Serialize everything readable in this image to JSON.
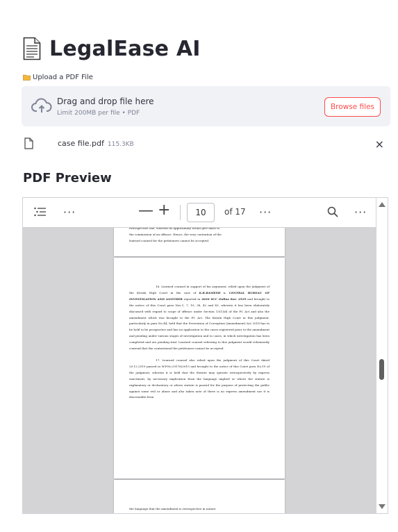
{
  "app": {
    "title": "LegalEase AI",
    "icon": "document-icon"
  },
  "uploader": {
    "label": "Upload a PDF File",
    "drop_text": "Drag and drop file here",
    "limit_text": "Limit 200MB per file • PDF",
    "browse_label": "Browse files",
    "accent_color": "#ff4b4b"
  },
  "uploaded_file": {
    "name": "case file.pdf",
    "size": "115.3KB",
    "remove_label": "×"
  },
  "preview": {
    "heading": "PDF Preview",
    "toolbar": {
      "more": "···",
      "zoom_out": "—",
      "zoom_in": "+",
      "current_page": "10",
      "page_total": "of 17"
    },
    "page_prev_text": [
      "retrospective one, wherein its applicability would give basis to",
      "the commission of an offence. Hence, the very contention of the",
      "learned counsel for the petitioners cannot be accepted."
    ],
    "page_main": {
      "para16_lead": "16.",
      "para16_a": "Learned counsel in support of his argument, relied upon the judgment of the Kerala High Court in the case of",
      "para16_case": "K.R.RAMESH v. CENTRAL BUREAU OF INVESTIGATION AND ANOTHER",
      "para16_b": "reported in",
      "para16_cite": "2020 SCC Online Ker. 2529",
      "para16_c": "and brought to the notice of this Court para Nos.1, 7, 10, 38, 42 and 43, wherein it has been elaborately discussed with regard to scope of offence under Section 13(1)(d) of the PC Act and also the amendment which was brought to the PC Act. The Kerala High Court in this judgment, particularly in para No.44, held that the Prevention of Corruption (Amendment) Act 2018 has to be held to be prospective and has no application to the cases registered prior to the amendment and pending under various stages of investigation and to cases, in which investigation has been completed and are pending trial. Learned counsel referring to this judgment would vehemently contend that the contentionof the petitioners cannot be accepted.",
      "para17_lead": "17.",
      "para17": "Learned counsel also relied upon the judgment of this Court dated 20.12.2019 passed in W.P.No.29176/2019 and brought to the notice of this Court para No.19 of the judgment, wherein it is held that the Statute may operate retrospectively by express enactment, by necessary implication from the language implied or where the statute is explanatory or declaratory or where statute is passed for the purpose of protecting the public against some evil or abuse and also taken note of there is no express amendment nor it is discernable from"
    },
    "page_next_text": "the language that the amendment is retrospective in nature"
  }
}
